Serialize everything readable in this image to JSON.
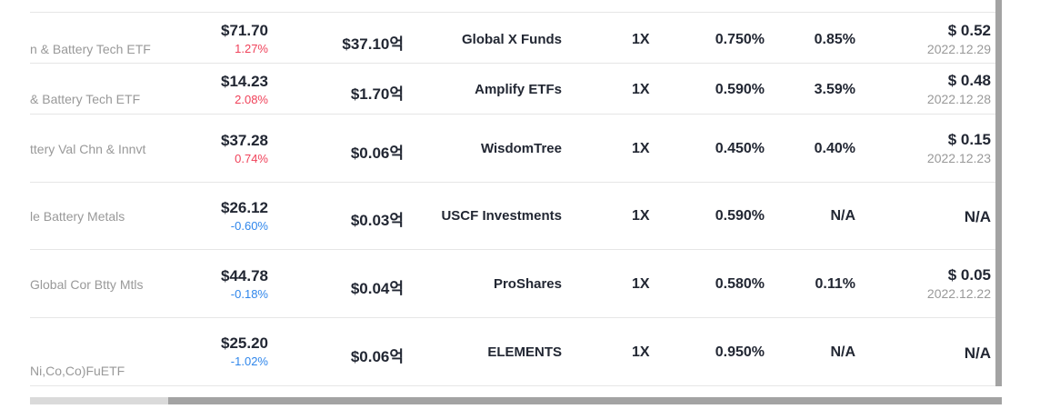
{
  "rows": [
    {
      "name": "n & Battery Tech ETF",
      "price": "$71.70",
      "change": "1.27%",
      "dir": "up",
      "aum": "$37.10억",
      "issuer": "Global X Funds",
      "leverage": "1X",
      "fee": "0.750%",
      "yield": "0.85%",
      "dividend": "$ 0.52",
      "div_date": "2022.12.29"
    },
    {
      "name": "& Battery Tech ETF",
      "price": "$14.23",
      "change": "2.08%",
      "dir": "up",
      "aum": "$1.70억",
      "issuer": "Amplify ETFs",
      "leverage": "1X",
      "fee": "0.590%",
      "yield": "3.59%",
      "dividend": "$ 0.48",
      "div_date": "2022.12.28"
    },
    {
      "name": "ttery Val Chn & Innvt",
      "price": "$37.28",
      "change": "0.74%",
      "dir": "up",
      "aum": "$0.06억",
      "issuer": "WisdomTree",
      "leverage": "1X",
      "fee": "0.450%",
      "yield": "0.40%",
      "dividend": "$ 0.15",
      "div_date": "2022.12.23"
    },
    {
      "name": "le Battery Metals",
      "price": "$26.12",
      "change": "-0.60%",
      "dir": "down",
      "aum": "$0.03억",
      "issuer": "USCF Investments",
      "leverage": "1X",
      "fee": "0.590%",
      "yield": "N/A",
      "dividend": "N/A",
      "div_date": ""
    },
    {
      "name": "Global Cor Btty Mtls",
      "price": "$44.78",
      "change": "-0.18%",
      "dir": "down",
      "aum": "$0.04억",
      "issuer": "ProShares",
      "leverage": "1X",
      "fee": "0.580%",
      "yield": "0.11%",
      "dividend": "$ 0.05",
      "div_date": "2022.12.22"
    },
    {
      "name": "Ni,Co,Co)FuETF",
      "price": "$25.20",
      "change": "-1.02%",
      "dir": "down",
      "aum": "$0.06억",
      "issuer": "ELEMENTS",
      "leverage": "1X",
      "fee": "0.950%",
      "yield": "N/A",
      "dividend": "N/A",
      "div_date": ""
    }
  ],
  "colors": {
    "up": "#f0425a",
    "down": "#2f86eb",
    "text": "#222733",
    "muted": "#999999",
    "border": "#e6e6e6",
    "scrollbar": "#a3a3a3"
  }
}
